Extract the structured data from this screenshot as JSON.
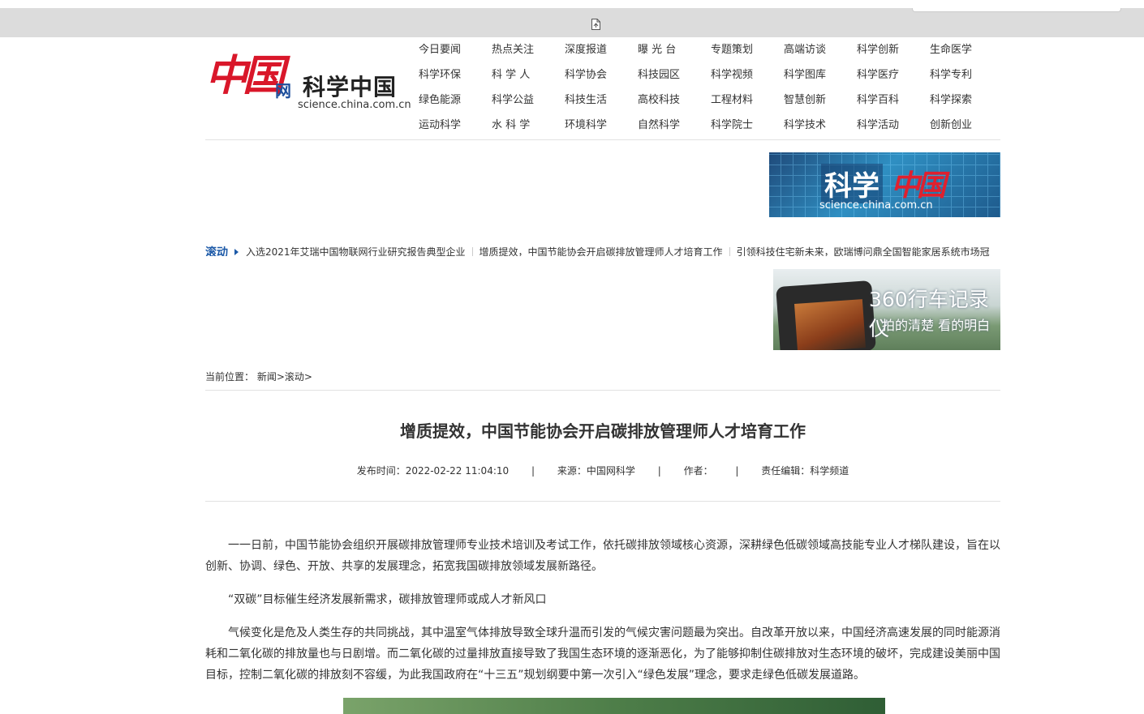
{
  "nav": {
    "rows": [
      [
        "今日要闻",
        "热点关注",
        "深度报道",
        "曝 光 台",
        "专题策划",
        "高端访谈",
        "科学创新",
        "生命医学"
      ],
      [
        "科学环保",
        "科 学 人",
        "科学协会",
        "科技园区",
        "科学视频",
        "科学图库",
        "科学医疗",
        "科学专利"
      ],
      [
        "绿色能源",
        "科学公益",
        "科技生活",
        "高校科技",
        "工程材料",
        "智慧创新",
        "科学百科",
        "科学探索"
      ],
      [
        "运动科学",
        "水 科 学",
        "环境科学",
        "自然科学",
        "科学院士",
        "科学技术",
        "科学活动",
        "创新创业"
      ]
    ]
  },
  "logo": {
    "glyph": "中国",
    "wang": "网",
    "name": "科学中国",
    "domain": "science.china.com.cn"
  },
  "banner1": {
    "kexue": "科学",
    "zhongguo": "中国",
    "domain": "science.china.com.cn"
  },
  "ticker": {
    "label": "滚动",
    "items": [
      "入选2021年艾瑞中国物联网行业研究报告典型企业",
      "增质提效，中国节能协会开启碳排放管理师人才培育工作",
      "引领科技住宅新未来，欧瑞博问鼎全国智能家居系统市场冠"
    ]
  },
  "ad": {
    "headline": "360行车记录仪",
    "slogan": "拍的清楚 看的明白",
    "brand": "360"
  },
  "breadcrumb": {
    "label": "当前位置：",
    "path": "新闻>滚动>"
  },
  "article": {
    "title": "增质提效，中国节能协会开启碳排放管理师人才培育工作",
    "publish_time": "发布时间：2022-02-22 11:04:10",
    "source": "来源：中国网科学",
    "author": "作者：",
    "editor": "责任编辑：科学频道",
    "separator": "|",
    "paragraphs": [
      "一一日前，中国节能协会组织开展碳排放管理师专业技术培训及考试工作，依托碳排放领域核心资源，深耕绿色低碳领域高技能专业人才梯队建设，旨在以创新、协调、绿色、开放、共享的发展理念，拓宽我国碳排放领域发展新路径。",
      "“双碳”目标催生经济发展新需求，碳排放管理师或成人才新风口",
      "气候变化是危及人类生存的共同挑战，其中温室气体排放导致全球升温而引发的气候灾害问题最为突出。自改革开放以来，中国经济高速发展的同时能源消耗和二氧化碳的排放量也与日剧增。而二氧化碳的过量排放直接导致了我国生态环境的逐渐恶化，为了能够抑制住碳排放对生态环境的破坏，完成建设美丽中国目标，控制二氧化碳的排放刻不容缓，为此我国政府在“十三五”规划纲要中第一次引入“绿色发展”理念，要求走绿色低碳发展道路。"
    ]
  },
  "colors": {
    "brand_red": "#d9172a",
    "link_blue": "#1d5aa8",
    "toolbar_gray": "#dcdcdc"
  }
}
